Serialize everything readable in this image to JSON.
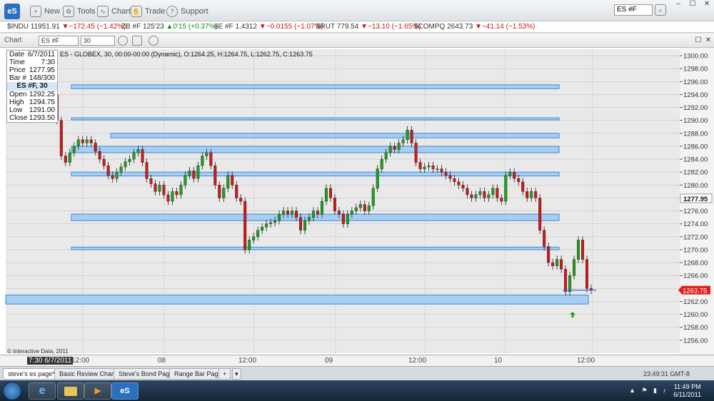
{
  "app": {
    "logo": "eS",
    "menu": [
      {
        "label": "New",
        "icon": "new-icon"
      },
      {
        "label": "Tools",
        "icon": "tools-icon"
      },
      {
        "label": "Chart",
        "icon": "chart-icon"
      },
      {
        "label": "Trade",
        "icon": "trade-icon"
      },
      {
        "label": "Support",
        "icon": "help-icon"
      }
    ],
    "symbol_input": "ES #F",
    "window_controls": [
      "–",
      "☐",
      "✕"
    ]
  },
  "ticker": [
    {
      "sym": "$INDU",
      "last": "11951.91",
      "chg": "▼−172.45 (−1.42%)",
      "dir": "down"
    },
    {
      "sym": "ZB #F",
      "last": "125'23",
      "chg": "▲0'15 (+0.37%)",
      "dir": "up"
    },
    {
      "sym": "6E #F",
      "last": "1.4312",
      "chg": "▼−0.0155 (−1.07%)",
      "dir": "down"
    },
    {
      "sym": "$RUT",
      "last": "779.54",
      "chg": "▼−13.10 (−1.65%)",
      "dir": "down"
    },
    {
      "sym": "$COMPQ",
      "last": "2643.73",
      "chg": "▼−41.14 (−1.53%)",
      "dir": "down"
    }
  ],
  "chart_toolbar": {
    "label": "Chart",
    "symbol": "ES #F",
    "interval": "30"
  },
  "chart_header": "ES - GLOBEX, 30, 00:00-00:00 (Dynamic), O:1264.25, H:1264.75, L:1262.75, C:1263.75",
  "info_box": {
    "top": [
      {
        "k": "Date",
        "v": "6/7/2011"
      },
      {
        "k": "Time",
        "v": "7:30"
      },
      {
        "k": "Price",
        "v": "1277.95"
      },
      {
        "k": "Bar #",
        "v": "148/300"
      }
    ],
    "head": "ES #F, 30",
    "bottom": [
      {
        "k": "Open",
        "v": "1292.25"
      },
      {
        "k": "High",
        "v": "1294.75"
      },
      {
        "k": "Low",
        "v": "1291.00"
      },
      {
        "k": "Close",
        "v": "1293.50"
      }
    ]
  },
  "copyright": "© Interactive Data, 2011",
  "time_axis": {
    "cursor_label": "7:30 6/7/2011",
    "labels": [
      "12:00",
      "08",
      "12:00",
      "09",
      "12:00",
      "10",
      "12:00"
    ]
  },
  "sheet_tabs": [
    "steve's es page*",
    "Basic Review Charts",
    "Steve's Bond Page",
    "Range Bar Page"
  ],
  "add_tab": "+",
  "status_clock": "23:49:31 GMT-8",
  "taskbar": {
    "apps": [
      "e",
      "",
      "",
      "eS"
    ],
    "time": "11:49 PM",
    "date": "6/11/2011"
  },
  "chart_data": {
    "type": "candlestick",
    "title": "ES - GLOBEX, 30, 00:00-00:00 (Dynamic), O:1264.25, H:1264.75, L:1262.75, C:1263.75",
    "ylim": [
      1254,
      1301
    ],
    "y_ticks": [
      1256,
      1258,
      1260,
      1262,
      1264,
      1266,
      1268,
      1270,
      1272,
      1274,
      1276,
      1278,
      1280,
      1282,
      1284,
      1286,
      1288,
      1290,
      1292,
      1294,
      1296,
      1298,
      1300
    ],
    "y_tick_labels": [
      "1256.00",
      "1258.00",
      "1260.00",
      "1262.00",
      "1264.00",
      "1266.00",
      "1268.00",
      "1270.00",
      "1272.00",
      "1274.00",
      "1276.00",
      "1278.00",
      "1280.00",
      "1282.00",
      "1284.00",
      "1286.00",
      "1288.00",
      "1290.00",
      "1292.00",
      "1294.00",
      "1296.00",
      "1298.00",
      "1300.00"
    ],
    "last_price": {
      "value": 1263.75,
      "label": "1263.75",
      "color": "#e02020"
    },
    "cursor_price": {
      "value": 1277.95,
      "label": "1277.95"
    },
    "colors": {
      "up": "#1ea01e",
      "down": "#d01818",
      "zone_fill": "#a8cdf0",
      "zone_stroke": "#3c8ad6",
      "grid": "#c8c8c8"
    },
    "closes": [
      1293.5,
      1292.8,
      1291.5,
      1292.5,
      1290.2,
      1291.8,
      1291.0,
      1292.3,
      1293.5,
      1295.5,
      1294.0,
      1290.0,
      1284.5,
      1283.5,
      1285.0,
      1286.0,
      1287.0,
      1286.5,
      1287.0,
      1286.5,
      1285.2,
      1284.0,
      1283.0,
      1281.5,
      1281.0,
      1282.0,
      1282.8,
      1283.6,
      1284.0,
      1285.0,
      1285.5,
      1283.5,
      1281.0,
      1280.2,
      1279.0,
      1280.0,
      1278.5,
      1277.5,
      1279.0,
      1278.5,
      1280.0,
      1281.5,
      1282.2,
      1281.0,
      1283.0,
      1284.5,
      1285.0,
      1283.0,
      1280.0,
      1278.0,
      1279.5,
      1281.5,
      1280.0,
      1278.0,
      1277.5,
      1270.0,
      1271.5,
      1272.0,
      1273.0,
      1273.5,
      1274.0,
      1274.2,
      1274.5,
      1275.5,
      1276.0,
      1275.5,
      1276.0,
      1275.0,
      1273.0,
      1274.5,
      1275.0,
      1276.0,
      1275.5,
      1277.5,
      1279.5,
      1278.0,
      1276.0,
      1275.5,
      1274.0,
      1275.5,
      1276.0,
      1276.5,
      1277.0,
      1276.0,
      1276.8,
      1279.5,
      1282.5,
      1284.0,
      1285.0,
      1286.0,
      1285.5,
      1286.5,
      1287.0,
      1288.5,
      1286.5,
      1283.5,
      1282.5,
      1282.8,
      1283.0,
      1282.5,
      1282.5,
      1282.0,
      1281.5,
      1281.0,
      1280.5,
      1280.0,
      1279.5,
      1278.5,
      1278.0,
      1278.5,
      1279.0,
      1278.0,
      1278.5,
      1279.5,
      1278.0,
      1277.5,
      1281.5,
      1282.0,
      1281.0,
      1280.5,
      1279.0,
      1278.0,
      1279.0,
      1278.0,
      1273.0,
      1270.5,
      1268.0,
      1267.5,
      1268.5,
      1267.0,
      1263.5,
      1266.0,
      1268.5,
      1271.5,
      1268.5,
      1264.0,
      1263.75
    ],
    "zones": [
      {
        "top": 1295.5,
        "bottom": 1294.9
      },
      {
        "top": 1290.4,
        "bottom": 1290.1
      },
      {
        "top": 1288.0,
        "bottom": 1287.3
      },
      {
        "top": 1286.0,
        "bottom": 1285.0
      },
      {
        "top": 1282.0,
        "bottom": 1281.4
      },
      {
        "top": 1275.5,
        "bottom": 1274.5
      },
      {
        "top": 1270.4,
        "bottom": 1270.0
      },
      {
        "top": 1263.0,
        "bottom": 1261.6
      }
    ]
  }
}
